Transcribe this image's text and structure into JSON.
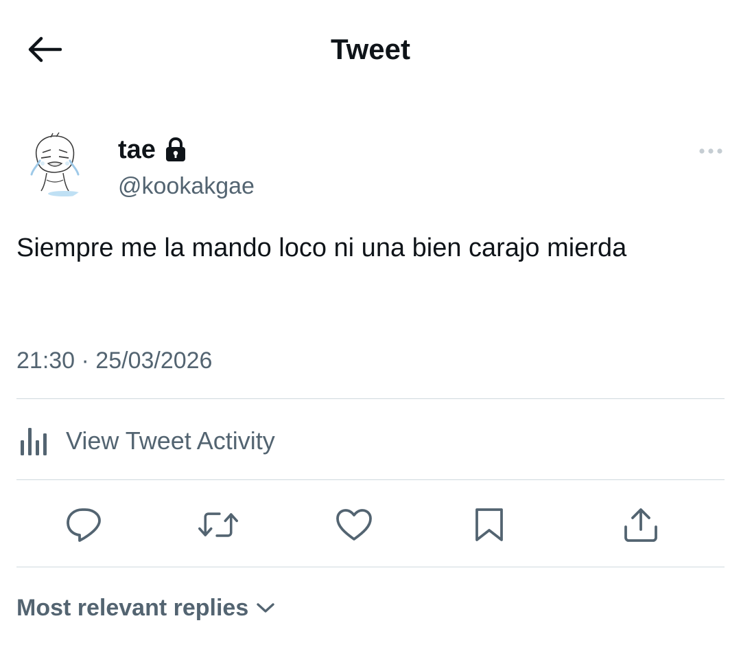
{
  "header": {
    "back_icon": "arrow-left-icon",
    "title": "Tweet"
  },
  "author": {
    "avatar_icon": "crying-cartoon-avatar",
    "display_name": "tae",
    "protected_icon": "lock-icon",
    "handle": "@kookakgae"
  },
  "tweet": {
    "text": "Siempre me la mando loco ni una bien carajo mierda",
    "timestamp": "21:30 · 25/03/2026",
    "more_icon": "more-horizontal-icon"
  },
  "activity": {
    "icon": "bar-chart-icon",
    "label": "View Tweet Activity"
  },
  "actions": [
    {
      "name": "reply",
      "icon": "reply-bubble-icon"
    },
    {
      "name": "retweet",
      "icon": "retweet-icon"
    },
    {
      "name": "like",
      "icon": "heart-icon"
    },
    {
      "name": "bookmark",
      "icon": "bookmark-icon"
    },
    {
      "name": "share",
      "icon": "share-icon"
    }
  ],
  "replies": {
    "sort_label": "Most relevant replies",
    "chevron_icon": "chevron-down-icon"
  },
  "colors": {
    "primary_text": "#0f1419",
    "secondary_text": "#536471",
    "divider": "#cfd9de",
    "background": "#ffffff"
  }
}
